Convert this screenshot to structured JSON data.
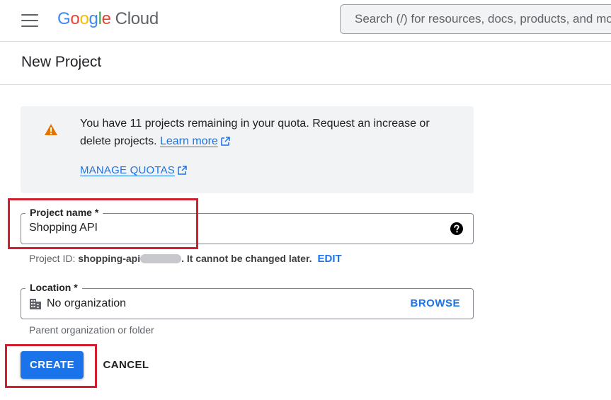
{
  "header": {
    "logo_letters": [
      "G",
      "o",
      "o",
      "g",
      "l",
      "e"
    ],
    "logo_product": "Cloud",
    "search_placeholder": "Search (/) for resources, docs, products, and more"
  },
  "page": {
    "title": "New Project"
  },
  "quota_notice": {
    "message": "You have 11 projects remaining in your quota. Request an increase or delete projects.",
    "learn_more_label": "Learn more",
    "manage_quotas_label": "MANAGE QUOTAS",
    "icon": "warning-icon",
    "icon_color": "#e37400"
  },
  "form": {
    "project_name": {
      "label": "Project name *",
      "value": "Shopping API",
      "icon": "help-icon"
    },
    "project_id_hint": {
      "prefix": "Project ID: ",
      "id": "shopping-api",
      "suffix": ". It cannot be changed later.",
      "edit_label": "EDIT"
    },
    "location": {
      "label": "Location *",
      "value": "No organization",
      "browse_label": "BROWSE",
      "icon": "building-icon",
      "hint": "Parent organization or folder"
    }
  },
  "actions": {
    "create_label": "CREATE",
    "cancel_label": "CANCEL"
  },
  "colors": {
    "accent": "#1a73e8",
    "highlight": "#d0202f",
    "notice_bg": "#f1f3f4"
  }
}
